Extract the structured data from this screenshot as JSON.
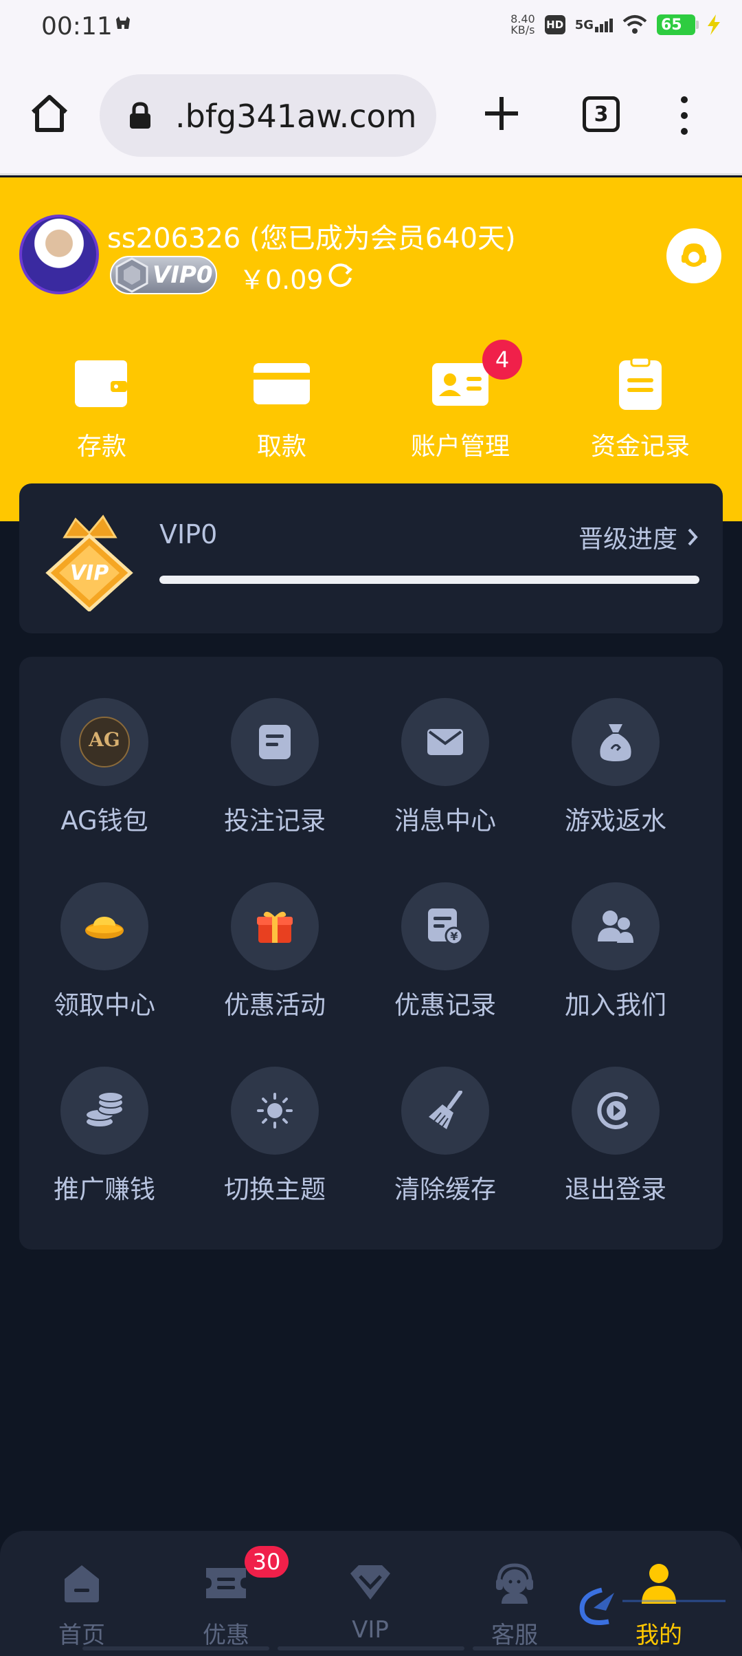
{
  "status_bar": {
    "time": "00:11",
    "net_speed_value": "8.40",
    "net_speed_unit": "KB/s",
    "hd": "HD",
    "network": "5G",
    "battery": "65"
  },
  "browser": {
    "url": ".bfg341aw.com",
    "tab_count": "3"
  },
  "profile": {
    "username": "ss206326 (您已成为会员640天)",
    "vip_badge": "VIP0",
    "balance": "￥0.09"
  },
  "quick_actions": [
    {
      "label": "存款"
    },
    {
      "label": "取款"
    },
    {
      "label": "账户管理",
      "badge": "4"
    },
    {
      "label": "资金记录"
    }
  ],
  "vip_card": {
    "level": "VIP0",
    "progress_link": "晋级进度",
    "progress_fraction": 1.0
  },
  "grid": {
    "items": [
      {
        "label": "AG钱包",
        "icon": "ag-wallet-icon"
      },
      {
        "label": "投注记录",
        "icon": "bet-record-icon"
      },
      {
        "label": "消息中心",
        "icon": "mail-icon"
      },
      {
        "label": "游戏返水",
        "icon": "money-bag-icon"
      },
      {
        "label": "领取中心",
        "icon": "gold-ingot-icon"
      },
      {
        "label": "优惠活动",
        "icon": "gift-icon"
      },
      {
        "label": "优惠记录",
        "icon": "bill-icon"
      },
      {
        "label": "加入我们",
        "icon": "users-icon"
      },
      {
        "label": "推广赚钱",
        "icon": "coins-icon"
      },
      {
        "label": "切换主题",
        "icon": "sun-icon"
      },
      {
        "label": "清除缓存",
        "icon": "broom-icon"
      },
      {
        "label": "退出登录",
        "icon": "logout-icon"
      }
    ]
  },
  "bottom_nav": [
    {
      "label": "首页"
    },
    {
      "label": "优惠",
      "badge": "30"
    },
    {
      "label": "VIP"
    },
    {
      "label": "客服"
    },
    {
      "label": "我的",
      "active": true
    }
  ],
  "colors": {
    "brand_yellow": "#ffc700",
    "background": "#0f1623",
    "card": "#1a2130",
    "badge_red": "#f0204a"
  }
}
